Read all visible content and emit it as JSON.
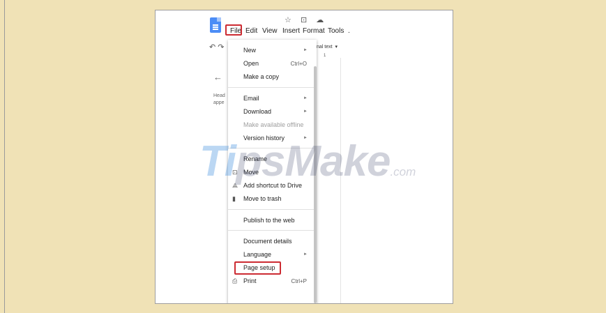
{
  "header": {
    "star_icon": "☆",
    "folder_icon": "⊡",
    "cloud_icon": "☁"
  },
  "menubar": {
    "items": [
      "File",
      "Edit",
      "View",
      "Insert",
      "Format",
      "Tools",
      "."
    ]
  },
  "toolbar": {
    "undo_icon": "↶",
    "redo_icon": "↷",
    "style": "nal text",
    "ruler": "1"
  },
  "outline": {
    "back_icon": "←",
    "text_line1": "Head",
    "text_line2": "appe"
  },
  "file_menu": {
    "new": "New",
    "open": "Open",
    "open_shortcut": "Ctrl+O",
    "make_copy": "Make a copy",
    "email": "Email",
    "download": "Download",
    "offline": "Make available offline",
    "version_history": "Version history",
    "rename": "Rename",
    "move": "Move",
    "add_shortcut": "Add shortcut to Drive",
    "trash": "Move to trash",
    "publish": "Publish to the web",
    "details": "Document details",
    "language": "Language",
    "page_setup": "Page setup",
    "print": "Print",
    "print_shortcut": "Ctrl+P",
    "submenu_arrow": "►"
  },
  "watermark": {
    "ti": "Ti",
    "ps": "ps",
    "make": "Make",
    "com": ".com"
  },
  "colors": {
    "highlight": "#cc2b32",
    "docs_blue": "#4c8df6",
    "background": "#f0e2b6"
  }
}
